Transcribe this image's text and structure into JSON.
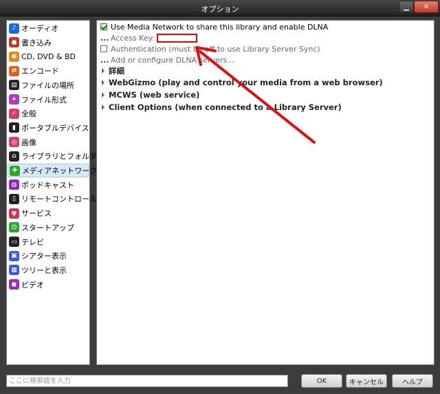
{
  "window": {
    "title": "オプション"
  },
  "sidebar": {
    "items": [
      {
        "label": "オーディオ",
        "icon": "music-note-icon",
        "color": "#1a6ad8",
        "glyph": "♪"
      },
      {
        "label": "書き込み",
        "icon": "burn-disc-icon",
        "color": "#c0392b",
        "glyph": "●"
      },
      {
        "label": "CD, DVD & BD",
        "icon": "cd-disc-icon",
        "color": "#e08a1e",
        "glyph": "◉"
      },
      {
        "label": "エンコード",
        "icon": "encode-icon",
        "color": "#e0601e",
        "glyph": "⇄"
      },
      {
        "label": "ファイルの場所",
        "icon": "folder-location-icon",
        "color": "#222222",
        "glyph": "▤"
      },
      {
        "label": "ファイル形式",
        "icon": "file-type-icon",
        "color": "#b03ac0",
        "glyph": "✦"
      },
      {
        "label": "全般",
        "icon": "general-settings-icon",
        "color": "#d8406a",
        "glyph": "✓"
      },
      {
        "label": "ポータブルデバイス",
        "icon": "portable-device-icon",
        "color": "#222222",
        "glyph": "▮"
      },
      {
        "label": "画像",
        "icon": "camera-icon",
        "color": "#d83a7a",
        "glyph": "◎"
      },
      {
        "label": "ライブラリとフォルダ",
        "icon": "library-house-icon",
        "color": "#222222",
        "glyph": "⌂"
      },
      {
        "label": "メディアネットワーク",
        "icon": "media-network-icon",
        "color": "#2aa82a",
        "glyph": "✚"
      },
      {
        "label": "ポッドキャスト",
        "icon": "podcast-icon",
        "color": "#8a2ac0",
        "glyph": "◍"
      },
      {
        "label": "リモートコントロール",
        "icon": "remote-control-icon",
        "color": "#222222",
        "glyph": "▯"
      },
      {
        "label": "サービス",
        "icon": "plug-service-icon",
        "color": "#d8305a",
        "glyph": "ψ"
      },
      {
        "label": "スタートアップ",
        "icon": "power-startup-icon",
        "color": "#2aa82a",
        "glyph": "⏻"
      },
      {
        "label": "テレビ",
        "icon": "tv-icon",
        "color": "#222222",
        "glyph": "▭"
      },
      {
        "label": "シアター表示",
        "icon": "theater-view-icon",
        "color": "#3a5ad8",
        "glyph": "▣"
      },
      {
        "label": "ツリーと表示",
        "icon": "tree-view-icon",
        "color": "#3a5ad8",
        "glyph": "▦"
      },
      {
        "label": "ビデオ",
        "icon": "video-camera-icon",
        "color": "#9a2ac0",
        "glyph": "◼"
      }
    ],
    "selected_index": 10
  },
  "panel": {
    "use_media_network": {
      "label": "Use Media Network to share this library and enable DLNA",
      "checked": true
    },
    "access_key": {
      "dots": "...",
      "label": "Access Key:",
      "value": ""
    },
    "authentication": {
      "label": "Authentication (must be off to use Library Server Sync)",
      "checked": false
    },
    "dlna_servers": {
      "dots": "...",
      "label": "Add or configure DLNA servers..."
    },
    "sections": [
      {
        "label": "詳細"
      },
      {
        "label": "WebGizmo (play and control your media from a web browser)"
      },
      {
        "label": "MCWS (web service)"
      },
      {
        "label": "Client Options (when connected to a Library Server)"
      }
    ]
  },
  "bottom": {
    "search_placeholder": "ここに検索語を入力",
    "ok_label": "OK",
    "cancel_label": "キャンセル",
    "help_label": "ヘルプ"
  },
  "colors": {
    "annotation_red": "#e01010",
    "selected_bg": "#d8e8f8"
  }
}
